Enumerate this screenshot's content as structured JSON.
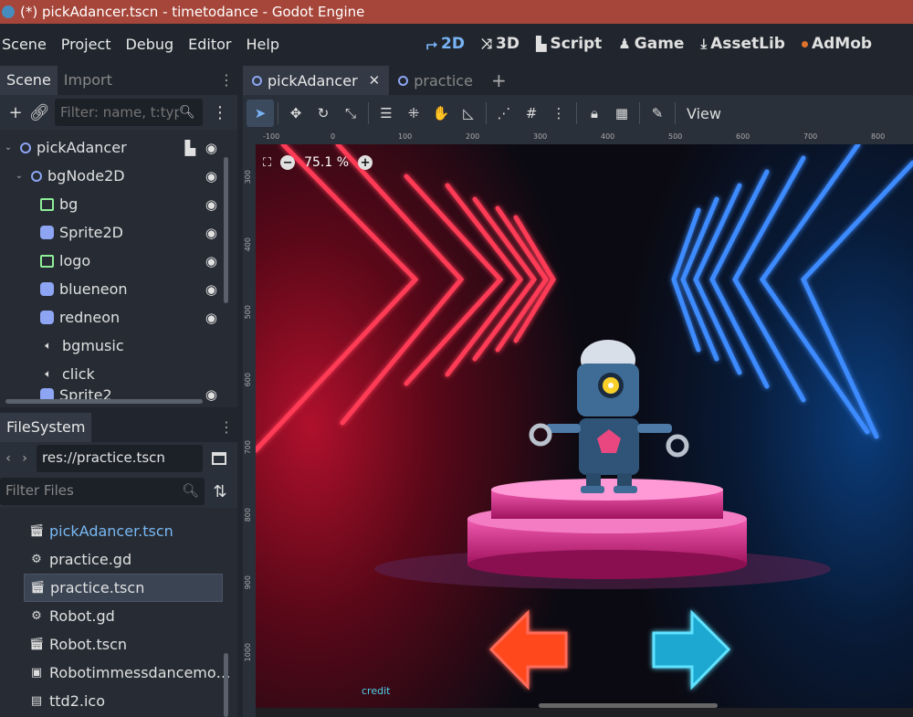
{
  "window": {
    "title": "(*) pickAdancer.tscn - timetodance - Godot Engine"
  },
  "menu": [
    "Scene",
    "Project",
    "Debug",
    "Editor",
    "Help"
  ],
  "workspaces": [
    {
      "label": "2D",
      "glyph": "⮣",
      "active": true
    },
    {
      "label": "3D",
      "glyph": "⤨",
      "active": false
    },
    {
      "label": "Script",
      "glyph": "▙",
      "active": false
    },
    {
      "label": "Game",
      "glyph": "♟",
      "active": false
    },
    {
      "label": "AssetLib",
      "glyph": "⤓",
      "active": false
    },
    {
      "label": "AdMob",
      "glyph": "",
      "active": false
    }
  ],
  "scene_dock": {
    "tabs": [
      "Scene",
      "Import"
    ],
    "filter_placeholder": "Filter: name, t:typ",
    "nodes": [
      {
        "name": "pickAdancer",
        "icon": "node2d",
        "depth": 0,
        "arrow": "⌄",
        "script": true,
        "eye": true
      },
      {
        "name": "bgNode2D",
        "icon": "node2d",
        "depth": 1,
        "arrow": "⌄",
        "script": false,
        "eye": true
      },
      {
        "name": "bg",
        "icon": "image",
        "depth": 2,
        "arrow": "",
        "script": false,
        "eye": true
      },
      {
        "name": "Sprite2D",
        "icon": "sprite",
        "depth": 2,
        "arrow": "",
        "script": false,
        "eye": true
      },
      {
        "name": "logo",
        "icon": "image",
        "depth": 2,
        "arrow": "",
        "script": false,
        "eye": true
      },
      {
        "name": "blueneon",
        "icon": "sprite",
        "depth": 2,
        "arrow": "",
        "script": false,
        "eye": true
      },
      {
        "name": "redneon",
        "icon": "sprite",
        "depth": 2,
        "arrow": "",
        "script": false,
        "eye": true
      },
      {
        "name": "bgmusic",
        "icon": "audio",
        "depth": 2,
        "arrow": "",
        "script": false,
        "eye": false
      },
      {
        "name": "click",
        "icon": "audio",
        "depth": 2,
        "arrow": "",
        "script": false,
        "eye": false
      },
      {
        "name": "Sprite2",
        "icon": "sprite",
        "depth": 2,
        "arrow": "",
        "script": false,
        "eye": true
      }
    ]
  },
  "filesystem_dock": {
    "tab": "FileSystem",
    "path": "res://practice.tscn",
    "filter_placeholder": "Filter Files",
    "files": [
      {
        "name": "pickAdancer.tscn",
        "type": "scene",
        "highlight": true,
        "selected": false
      },
      {
        "name": "practice.gd",
        "type": "script",
        "highlight": false,
        "selected": false
      },
      {
        "name": "practice.tscn",
        "type": "scene",
        "highlight": false,
        "selected": true
      },
      {
        "name": "Robot.gd",
        "type": "script",
        "highlight": false,
        "selected": false
      },
      {
        "name": "Robot.tscn",
        "type": "scene",
        "highlight": false,
        "selected": false
      },
      {
        "name": "Robotimmessdancemo…",
        "type": "model",
        "highlight": false,
        "selected": false
      },
      {
        "name": "ttd2.ico",
        "type": "file",
        "highlight": false,
        "selected": false
      }
    ]
  },
  "editor": {
    "tabs": [
      {
        "label": "pickAdancer",
        "active": true,
        "closable": true
      },
      {
        "label": "practice",
        "active": false,
        "closable": false
      }
    ],
    "view_label": "View",
    "zoom": "75.1 %",
    "ruler_x": [
      "-100",
      "0",
      "100",
      "200",
      "300",
      "400",
      "500",
      "600",
      "700",
      "800"
    ],
    "ruler_y": [
      "300",
      "400",
      "500",
      "600",
      "700",
      "800",
      "900",
      "1000"
    ],
    "credit": "credit"
  },
  "colors": {
    "accent": "#78b4f5",
    "titlebar": "#a6463a",
    "red_neon": "#ff2e4a",
    "blue_neon": "#3c8bff",
    "pedestal": "#e0338f"
  }
}
